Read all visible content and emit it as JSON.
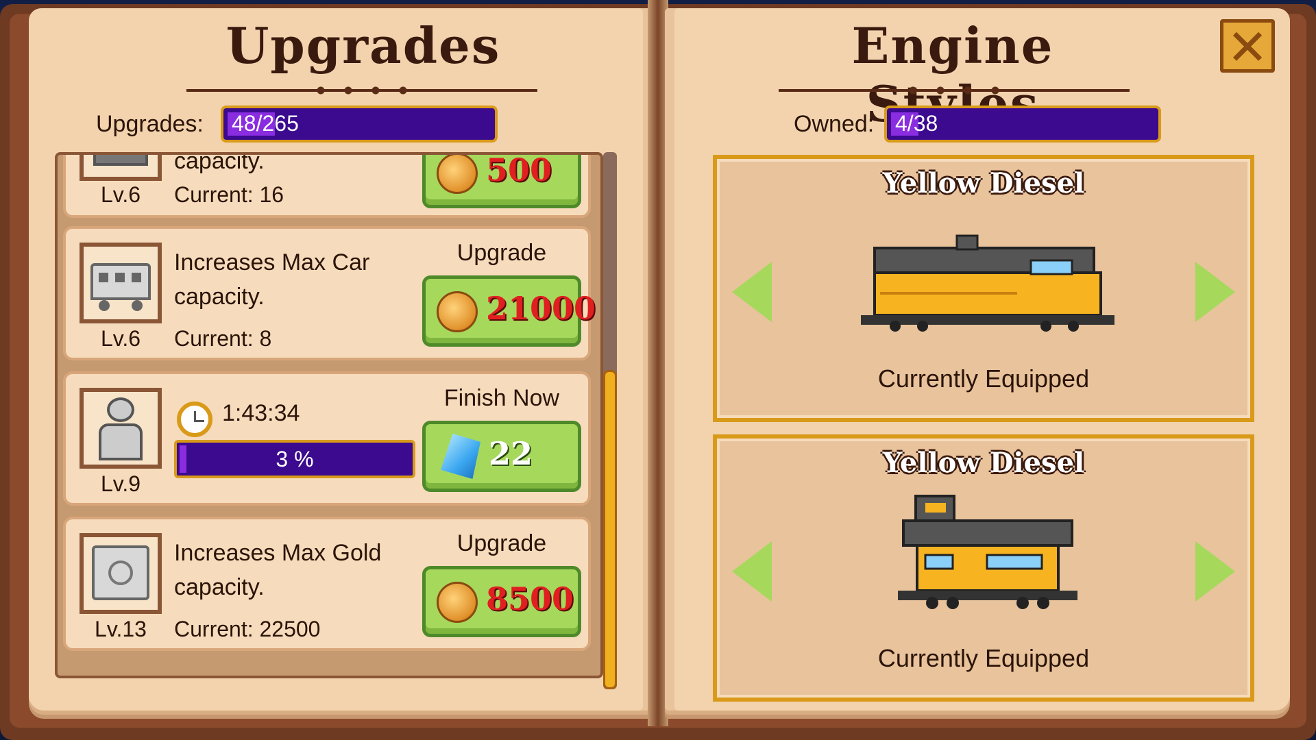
{
  "upgrades_page": {
    "title": "Upgrades",
    "count_label": "Upgrades:",
    "count_value": "48/265",
    "count_fraction": 0.18,
    "items": [
      {
        "icon": "train-car-icon",
        "desc_line2": "capacity.",
        "level": "Lv.6",
        "current": "Current: 16",
        "price": "500"
      },
      {
        "icon": "passenger-car-icon",
        "desc_line1": "Increases Max Car",
        "desc_line2": "capacity.",
        "level": "Lv.6",
        "current": "Current: 8",
        "action_label": "Upgrade",
        "price": "21000"
      },
      {
        "icon": "worker-icon",
        "level": "Lv.9",
        "timer": "1:43:34",
        "progress_text": "3 %",
        "progress": 0.03,
        "action_label": "Finish Now",
        "gem_price": "22"
      },
      {
        "icon": "safe-icon",
        "desc_line1": "Increases Max Gold",
        "desc_line2": "capacity.",
        "level": "Lv.13",
        "current": "Current: 22500",
        "action_label": "Upgrade",
        "price": "8500"
      }
    ]
  },
  "engine_page": {
    "title": "Engine Styles",
    "count_label": "Owned:",
    "count_value": "4/38",
    "count_fraction": 0.105,
    "styles": [
      {
        "name": "Yellow Diesel",
        "status": "Currently Equipped",
        "icon": "diesel-locomotive-icon"
      },
      {
        "name": "Yellow Diesel",
        "status": "Currently Equipped",
        "icon": "caboose-icon"
      }
    ]
  },
  "colors": {
    "page": "#f2d3ae",
    "bar": "#3b0a8e",
    "bar_fill": "#8a2ce0",
    "button_green": "#a6d85c",
    "price_red": "#e02020",
    "gold_border": "#d99a1a"
  }
}
